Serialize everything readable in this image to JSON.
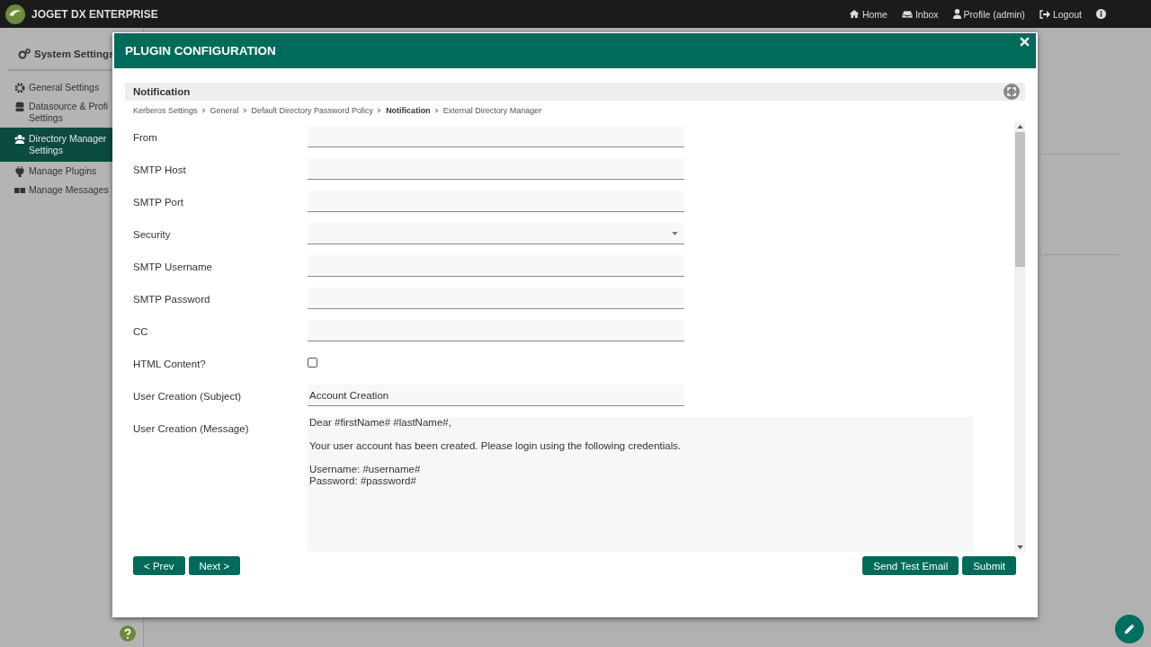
{
  "topbar": {
    "brand": "JOGET DX ENTERPRISE",
    "links": [
      {
        "label": "Home"
      },
      {
        "label": "Inbox"
      },
      {
        "label": "Profile (admin)"
      },
      {
        "label": "Logout"
      }
    ]
  },
  "sidebar": {
    "title": "System Settings",
    "items": [
      {
        "label": "General Settings",
        "selected": false
      },
      {
        "label": "Datasource & Profi\nSettings",
        "selected": false
      },
      {
        "label": "Directory Manager\nSettings",
        "selected": true
      },
      {
        "label": "Manage Plugins",
        "selected": false
      },
      {
        "label": "Manage Messages",
        "selected": false
      }
    ]
  },
  "dialog": {
    "title": "PLUGIN CONFIGURATION",
    "section": "Notification",
    "breadcrumb": [
      {
        "label": "Kerberos Settings",
        "current": false
      },
      {
        "label": "General",
        "current": false
      },
      {
        "label": "Default Directory Password Policy",
        "current": false
      },
      {
        "label": "Notification",
        "current": true
      },
      {
        "label": "External Directory Manager",
        "current": false
      }
    ],
    "fields": [
      {
        "label": "From",
        "kind": "text"
      },
      {
        "label": "SMTP Host",
        "kind": "text"
      },
      {
        "label": "SMTP Port",
        "kind": "text"
      },
      {
        "label": "Security",
        "kind": "select"
      },
      {
        "label": "SMTP Username",
        "kind": "text"
      },
      {
        "label": "SMTP Password",
        "kind": "text"
      },
      {
        "label": "CC",
        "kind": "text"
      },
      {
        "label": "HTML Content?",
        "kind": "checkbox",
        "checked": false
      },
      {
        "label": "User Creation (Subject)",
        "kind": "text",
        "value": "Account Creation"
      },
      {
        "label": "User Creation (Message)",
        "kind": "textarea",
        "value": "Dear #firstName# #lastName#,\n\nYour user account has been created. Please login using the following credentials.\n\nUsername: #username#\nPassword: #password#"
      }
    ],
    "left_buttons": [
      "< Prev",
      "Next >"
    ],
    "right_buttons": [
      "Send Test Email",
      "Submit"
    ]
  }
}
